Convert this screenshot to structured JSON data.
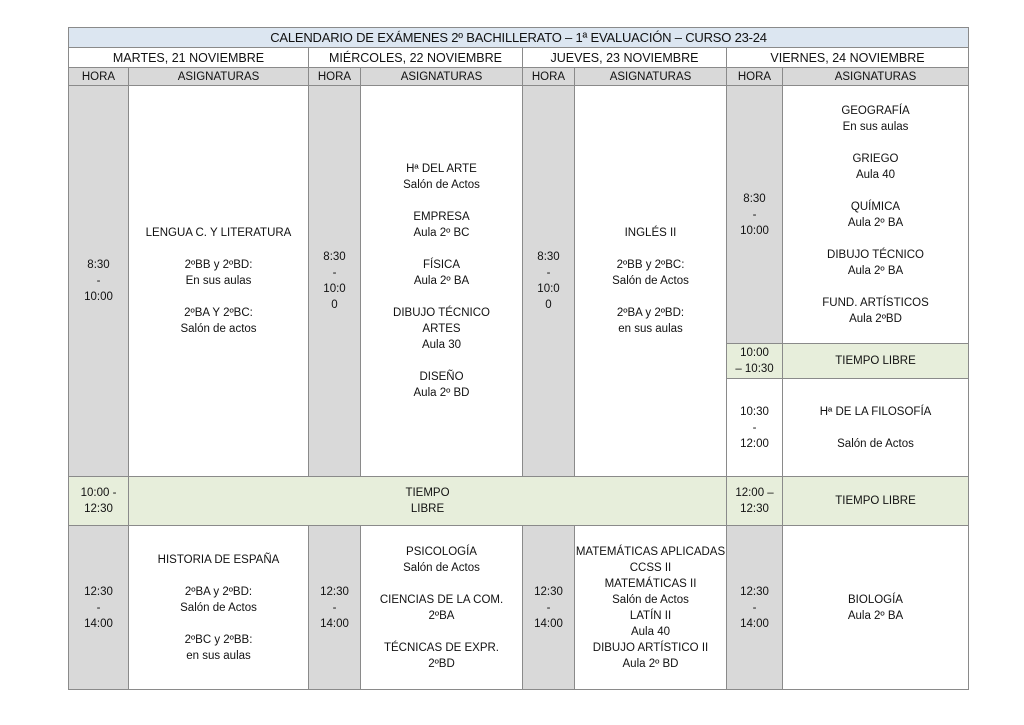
{
  "title": "CALENDARIO DE EXÁMENES 2º BACHILLERATO – 1ª EVALUACIÓN – CURSO 23-24",
  "headers": {
    "hora": "HORA",
    "asignaturas": "ASIGNATURAS"
  },
  "days": [
    {
      "name": "MARTES, 21 NOVIEMBRE",
      "s1": {
        "time": [
          "8:30",
          "-",
          "10:00"
        ],
        "lines": [
          "LENGUA C. Y LITERATURA",
          "",
          "2ºBB y 2ºBD:",
          "En sus aulas",
          "",
          "2ºBA Y 2ºBC:",
          "Salón de actos"
        ]
      },
      "s2": {
        "time": [
          "12:30",
          "-",
          "14:00"
        ],
        "lines": [
          "HISTORIA DE ESPAÑA",
          "",
          "2ºBA y 2ºBD:",
          "Salón de Actos",
          "",
          "2ºBC y 2ºBB:",
          "en sus aulas"
        ]
      }
    },
    {
      "name": "MIÉRCOLES, 22 NOVIEMBRE",
      "s1": {
        "time": [
          "8:30",
          "-",
          "10:0",
          "0"
        ],
        "lines": [
          "Hª DEL ARTE",
          "Salón de Actos",
          "",
          "EMPRESA",
          "Aula 2º BC",
          "",
          "FÍSICA",
          "Aula 2º BA",
          "",
          "DIBUJO TÉCNICO",
          "ARTES",
          "Aula 30",
          "",
          "DISEÑO",
          "Aula 2º BD"
        ]
      },
      "s2": {
        "time": [
          "12:30",
          "-",
          "14:00"
        ],
        "lines": [
          "PSICOLOGÍA",
          "Salón de Actos",
          "",
          "CIENCIAS DE LA COM.",
          "2ºBA",
          "",
          "TÉCNICAS DE EXPR.",
          "2ºBD"
        ]
      }
    },
    {
      "name": "JUEVES, 23 NOVIEMBRE",
      "s1": {
        "time": [
          "8:30",
          "-",
          "10:0",
          "0"
        ],
        "lines": [
          "INGLÉS II",
          "",
          "2ºBB y 2ºBC:",
          "Salón de Actos",
          "",
          "2ºBA y 2ºBD:",
          "en sus aulas"
        ]
      },
      "s2": {
        "time": [
          "12:30",
          "-",
          "14:00"
        ],
        "lines": [
          "MATEMÁTICAS APLICADAS",
          "CCSS II",
          "MATEMÁTICAS II",
          "Salón de Actos",
          "LATÍN II",
          "Aula 40",
          "DIBUJO ARTÍSTICO II",
          "Aula 2º BD"
        ]
      }
    },
    {
      "name": "VIERNES, 24 NOVIEMBRE",
      "s1": {
        "time": [
          "8:30",
          "-",
          "10:00"
        ],
        "lines": [
          "GEOGRAFÍA",
          "En sus aulas",
          "",
          "GRIEGO",
          "Aula 40",
          "",
          "QUÍMICA",
          "Aula 2º BA",
          "",
          "DIBUJO TÉCNICO",
          "Aula 2º BA",
          "",
          "FUND. ARTÍSTICOS",
          "Aula 2ºBD"
        ]
      },
      "free1": {
        "time": [
          "10:00",
          "– 10:30"
        ],
        "label": "TIEMPO LIBRE"
      },
      "s_mid": {
        "time": [
          "10:30",
          "-",
          "12:00"
        ],
        "lines": [
          "Hª DE LA FILOSOFÍA",
          "",
          "Salón de Actos"
        ]
      },
      "free2": {
        "time": [
          "12:00 –",
          "12:30"
        ],
        "label": "TIEMPO LIBRE"
      },
      "s2": {
        "time": [
          "12:30",
          "-",
          "14:00"
        ],
        "lines": [
          "BIOLOGÍA",
          "Aula 2º BA"
        ]
      }
    }
  ],
  "break": {
    "time": [
      "10:00 -",
      "12:30"
    ],
    "label": [
      "TIEMPO",
      "LIBRE"
    ]
  }
}
